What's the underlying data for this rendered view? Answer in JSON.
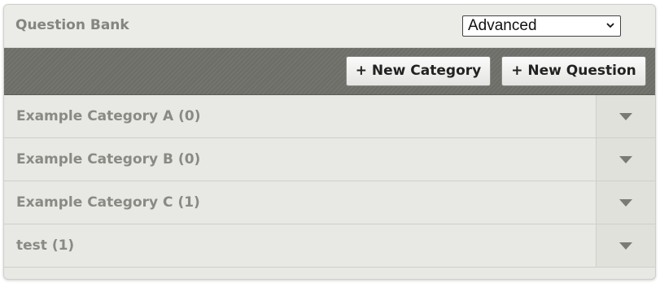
{
  "header": {
    "title": "Question Bank",
    "mode_select": {
      "selected": "Advanced"
    }
  },
  "toolbar": {
    "new_category_label": "+ New Category",
    "new_question_label": "+ New Question"
  },
  "categories": [
    {
      "label": "Example Category A (0)"
    },
    {
      "label": "Example Category B (0)"
    },
    {
      "label": "Example Category C (1)"
    },
    {
      "label": "test (1)"
    }
  ],
  "colors": {
    "panel_bg": "#e8e8e4",
    "toolbar_bg": "#6e6e69",
    "muted_text": "#8a8a85"
  },
  "icons": {
    "select_chevron": "chevron-down-icon",
    "row_toggle": "caret-down-icon"
  }
}
